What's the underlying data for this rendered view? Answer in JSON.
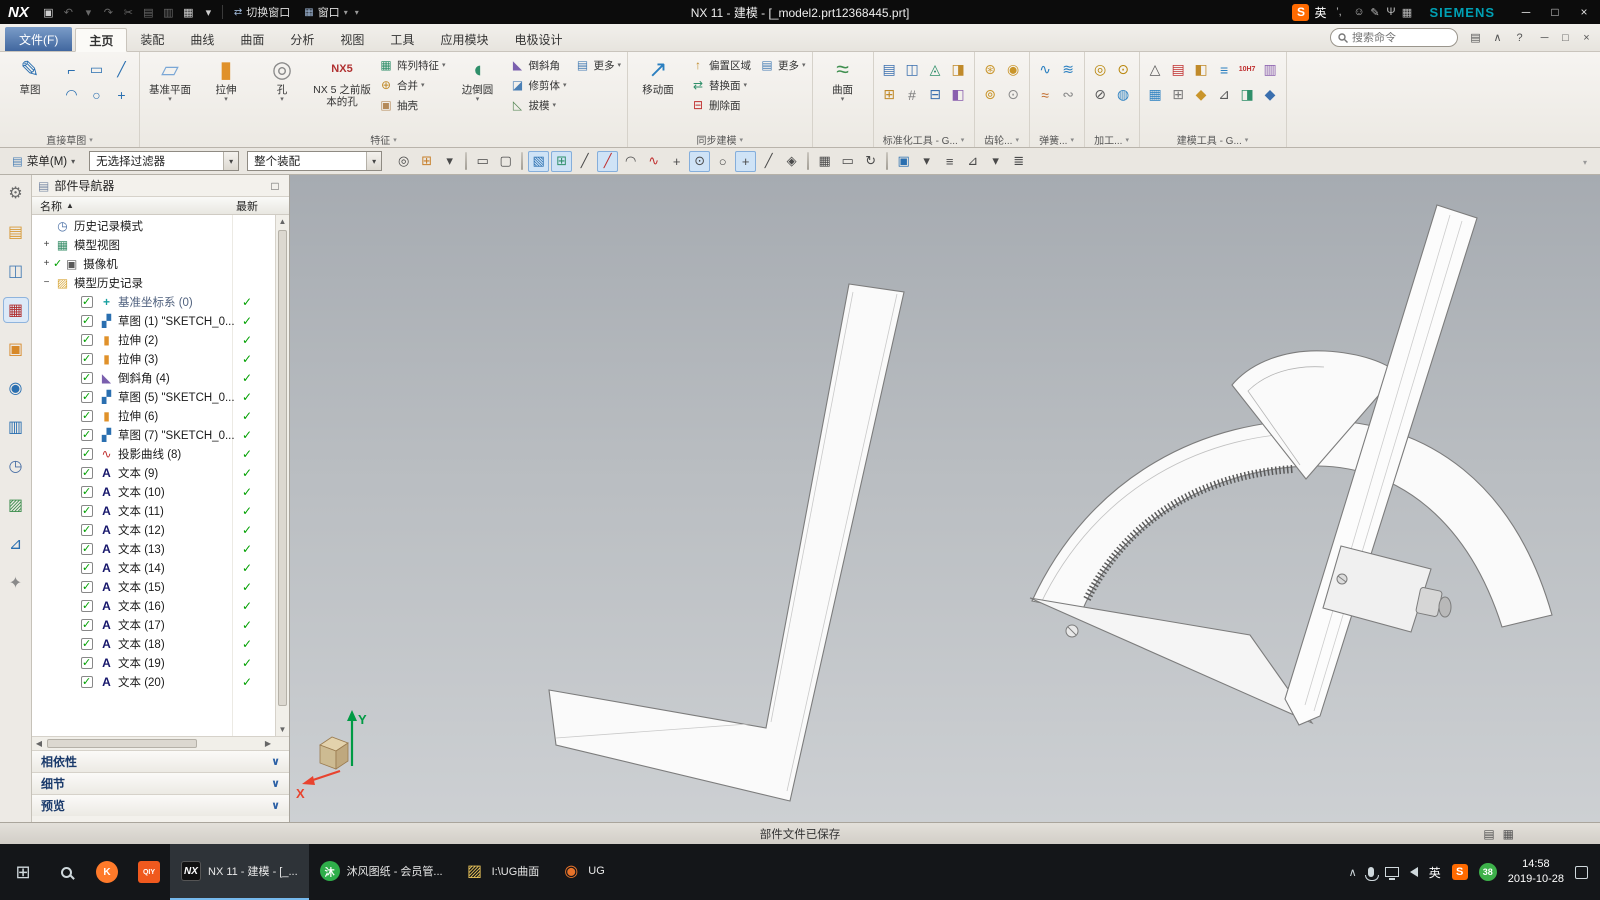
{
  "title_bar": {
    "logo": "NX",
    "title": "NX 11 - 建模 - [_model2.prt12368445.prt]",
    "qa_icons": [
      {
        "g": "▣",
        "n": "save-button"
      },
      {
        "g": "↶",
        "n": "undo-button",
        "dim": true
      },
      {
        "g": "▾",
        "n": "undo-caret",
        "dim": true
      },
      {
        "g": "↷",
        "n": "redo-button",
        "dim": true
      },
      {
        "g": "✂",
        "n": "cut-button",
        "dim": true
      },
      {
        "g": "▤",
        "n": "copy-button",
        "dim": true
      },
      {
        "g": "▥",
        "n": "paste-button",
        "dim": true
      },
      {
        "g": "▦",
        "n": "capture-button"
      },
      {
        "g": "▾",
        "n": "capture-caret"
      }
    ],
    "switch_window_icon": "⇄",
    "switch_window": "切换窗口",
    "window_icon": "▦",
    "window_menu": "窗口",
    "ime": {
      "sogou": "S",
      "lang": "英",
      "punct": "’,",
      "icons": [
        {
          "g": "☺",
          "n": "ime-emoji-icon"
        },
        {
          "g": "✎",
          "n": "ime-pen-icon"
        },
        {
          "g": "Ψ",
          "n": "ime-mic-icon"
        },
        {
          "g": "▦",
          "n": "ime-keyboard-icon"
        }
      ]
    },
    "brand": "SIEMENS",
    "window_controls": [
      {
        "g": "─",
        "n": "minimize-button"
      },
      {
        "g": "□",
        "n": "restore-button"
      },
      {
        "g": "×",
        "n": "close-button"
      }
    ]
  },
  "tabs": {
    "file": "文件(F)",
    "items": [
      {
        "label": "主页",
        "active": true
      },
      {
        "label": "装配"
      },
      {
        "label": "曲线"
      },
      {
        "label": "曲面"
      },
      {
        "label": "分析"
      },
      {
        "label": "视图"
      },
      {
        "label": "工具"
      },
      {
        "label": "应用模块"
      },
      {
        "label": "电极设计"
      }
    ],
    "search_placeholder": "搜索命令",
    "right_icons": [
      {
        "g": "▤",
        "n": "ribbon-options-icon"
      },
      {
        "g": "∧",
        "n": "minimize-ribbon-icon"
      },
      {
        "g": "?",
        "n": "help-icon"
      }
    ],
    "doc_controls": [
      {
        "g": "─",
        "n": "doc-minimize-button"
      },
      {
        "g": "□",
        "n": "doc-restore-button"
      },
      {
        "g": "×",
        "n": "doc-close-button"
      }
    ]
  },
  "ribbon": {
    "sketch": {
      "big": "草图",
      "icon": "✎",
      "label": "直接草图",
      "curves": [
        {
          "g": "⌐",
          "n": "profile-icon",
          "s": "color:#2a6fb0"
        },
        {
          "g": "▭",
          "n": "rectangle-icon",
          "s": "color:#2a6fb0"
        },
        {
          "g": "╱",
          "n": "line-icon",
          "s": "color:#2a6fb0"
        },
        {
          "g": "◠",
          "n": "arc-icon",
          "s": "color:#2a6fb0"
        },
        {
          "g": "○",
          "n": "circle-icon",
          "s": "color:#2a6fb0"
        },
        {
          "g": "+",
          "n": "point-icon",
          "s": "color:#2a6fb0"
        }
      ]
    },
    "feature": {
      "label": "特征",
      "datum": "基准平面",
      "extrude": "拉伸",
      "hole": "孔",
      "nx5hole": "NX 5 之前版本的孔",
      "pattern": "阵列特征",
      "unite": "合并",
      "shell": "抽壳",
      "blend": "边倒圆",
      "chamfer": "倒斜角",
      "trim": "修剪体",
      "draft": "拔模",
      "more": "更多",
      "icons": {
        "datum": "▱",
        "extrude": "▮",
        "hole": "◎",
        "nx5": "NX5",
        "pattern": "▦",
        "unite": "⊕",
        "shell": "▣",
        "blend": "◖",
        "chamfer": "◣",
        "trim": "◪",
        "draft": "◺",
        "more": "▤"
      }
    },
    "sync": {
      "label": "同步建模",
      "move": "移动面",
      "offset": "偏置区域",
      "replace": "替换面",
      "del": "删除面",
      "more": "更多",
      "icons": {
        "move": "↗",
        "offset": "↑",
        "replace": "⇄",
        "del": "⊟",
        "more": "▤"
      }
    },
    "surface": {
      "big": "曲面",
      "icon": "≈"
    },
    "std": {
      "label": "标准化工具 - G...",
      "icons": [
        {
          "g": "▤",
          "n": "std-tool-icon-1",
          "s": "color:#3a6fae"
        },
        {
          "g": "⊞",
          "n": "std-tool-icon-2",
          "s": "color:#c08a2a"
        },
        {
          "g": "◫",
          "n": "std-tool-icon-3",
          "s": "color:#3a6fae"
        },
        {
          "g": "#",
          "n": "std-tool-icon-4",
          "s": "color:#7a7a7a"
        },
        {
          "g": "◬",
          "n": "std-tool-icon-5",
          "s": "color:#2f8f6a"
        },
        {
          "g": "⊟",
          "n": "std-tool-icon-6",
          "s": "color:#3a6fae"
        },
        {
          "g": "◨",
          "n": "std-tool-icon-7",
          "s": "color:#c08a2a"
        },
        {
          "g": "◧",
          "n": "std-tool-icon-8",
          "s": "color:#8a5fae"
        }
      ]
    },
    "gear": {
      "label": "齿轮...",
      "icons": [
        {
          "g": "⊛",
          "n": "gear-tool-icon-1",
          "s": "color:#c9952a"
        },
        {
          "g": "⊚",
          "n": "gear-tool-icon-2",
          "s": "color:#c9952a"
        },
        {
          "g": "◉",
          "n": "gear-tool-icon-3",
          "s": "color:#c9952a"
        },
        {
          "g": "⊙",
          "n": "gear-tool-icon-4",
          "s": "color:#8a8a8a"
        }
      ]
    },
    "spring": {
      "label": "弹簧...",
      "icons": [
        {
          "g": "∿",
          "n": "spring-tool-icon-1",
          "s": "color:#2a7fc0"
        },
        {
          "g": "≈",
          "n": "spring-tool-icon-2",
          "s": "color:#c06a2a"
        },
        {
          "g": "≋",
          "n": "spring-tool-icon-3",
          "s": "color:#2a7fc0"
        },
        {
          "g": "∾",
          "n": "spring-tool-icon-4",
          "s": "color:#8a8a8a"
        }
      ]
    },
    "mach": {
      "label": "加工...",
      "icons": [
        {
          "g": "◎",
          "n": "machining-tool-icon-1",
          "s": "color:#b8860b"
        },
        {
          "g": "⊘",
          "n": "machining-tool-icon-2",
          "s": "color:#5a5a5a"
        },
        {
          "g": "⊙",
          "n": "machining-tool-icon-3",
          "s": "color:#b8860b"
        },
        {
          "g": "◍",
          "n": "machining-tool-icon-4",
          "s": "color:#2a7fc0"
        }
      ]
    },
    "mod": {
      "label": "建模工具 - G...",
      "icons": [
        {
          "g": "△",
          "n": "modeling-tool-icon-1",
          "s": "color:#5a5a5a"
        },
        {
          "g": "▦",
          "n": "modeling-tool-icon-2",
          "s": "color:#2a7fc0"
        },
        {
          "g": "▤",
          "n": "modeling-tool-icon-3",
          "s": "color:#c03030"
        },
        {
          "g": "⊞",
          "n": "modeling-tool-icon-4",
          "s": "color:#7a7a7a"
        },
        {
          "g": "◧",
          "n": "modeling-tool-icon-5",
          "s": "color:#c08a2a"
        },
        {
          "g": "◆",
          "n": "modeling-tool-icon-6",
          "s": "color:#c9952a"
        },
        {
          "g": "≡",
          "n": "modeling-tool-icon-7",
          "s": "color:#2a7fc0"
        },
        {
          "g": "⊿",
          "n": "modeling-tool-icon-8",
          "s": "color:#5a5a5a"
        },
        {
          "g": "10H7",
          "n": "modeling-tool-icon-9",
          "s": "color:#c03030;font-size:7px;font-weight:bold"
        },
        {
          "g": "◨",
          "n": "modeling-tool-icon-10",
          "s": "color:#2f8f6a"
        },
        {
          "g": "▥",
          "n": "modeling-tool-icon-11",
          "s": "color:#8a5fae"
        },
        {
          "g": "◆",
          "n": "modeling-tool-icon-12",
          "s": "color:#3a6fae"
        }
      ]
    }
  },
  "toolbar2": {
    "menu_icon": "▤",
    "menu": "菜单(M)",
    "filter_value": "无选择过滤器",
    "scope_value": "整个装配",
    "icons": [
      {
        "g": "◎",
        "n": "magnify-cursor-icon"
      },
      {
        "g": "⊞",
        "n": "quick-pick-icon",
        "s": "color:#c77f2a"
      },
      {
        "g": "▾",
        "n": "selection-options-caret"
      },
      {
        "sep": true,
        "n": "separator"
      },
      {
        "g": "▭",
        "n": "rect-select-icon"
      },
      {
        "g": "▢",
        "n": "lasso-select-icon"
      },
      {
        "sep": true,
        "n": "separator"
      },
      {
        "g": "▧",
        "n": "shaded-view-icon",
        "active": true,
        "s": "color:#2a6fb0"
      },
      {
        "g": "⊞",
        "n": "color-grid-icon",
        "active": true,
        "s": "color:#2f8f6a"
      },
      {
        "g": "╱",
        "n": "snap-endpoint-icon"
      },
      {
        "g": "╱",
        "n": "snap-midpoint-icon",
        "active": true,
        "s": "color:#c03030"
      },
      {
        "g": "◠",
        "n": "snap-arc-icon"
      },
      {
        "g": "∿",
        "n": "snap-spline-icon",
        "s": "color:#c03030"
      },
      {
        "g": "+",
        "n": "snap-point-icon"
      },
      {
        "g": "⊙",
        "n": "snap-center-icon",
        "active": true
      },
      {
        "g": "○",
        "n": "snap-circle-icon"
      },
      {
        "g": "+",
        "n": "snap-intersection-icon",
        "active": true
      },
      {
        "g": "╱",
        "n": "snap-tangent-icon"
      },
      {
        "g": "◈",
        "n": "snap-quadrant-icon"
      },
      {
        "sep": true,
        "n": "separator"
      },
      {
        "g": "▦",
        "n": "wcs-dynamics-icon"
      },
      {
        "g": "▭",
        "n": "fit-window-icon"
      },
      {
        "g": "↻",
        "n": "rotate-view-icon"
      },
      {
        "sep": true,
        "n": "separator"
      },
      {
        "g": "▣",
        "n": "render-style-icon",
        "s": "color:#2a6fb0"
      },
      {
        "g": "▾",
        "n": "render-style-caret"
      },
      {
        "g": "≡",
        "n": "part-list-icon"
      },
      {
        "g": "⊿",
        "n": "datum-triangle-icon"
      },
      {
        "g": "▾",
        "n": "more-tools-caret"
      },
      {
        "g": "≣",
        "n": "layer-list-icon"
      }
    ]
  },
  "resource_bar": {
    "icons": [
      {
        "g": "⚙",
        "n": "resource-options-icon",
        "s": "color:#6a6a6a"
      },
      {
        "g": "▤",
        "n": "assembly-navigator-icon",
        "s": "color:#d79b3a"
      },
      {
        "g": "◫",
        "n": "constraint-navigator-icon",
        "s": "color:#4a7fb5"
      },
      {
        "g": "▦",
        "n": "part-navigator-icon",
        "s": "color:#b03030",
        "active": true
      },
      {
        "g": "▣",
        "n": "reuse-library-icon",
        "s": "color:#d7892a"
      },
      {
        "g": "◉",
        "n": "web-browser-icon",
        "s": "color:#2a6fb0"
      },
      {
        "g": "▥",
        "n": "hd3d-tool-icon",
        "s": "color:#2a6fb0"
      },
      {
        "g": "◷",
        "n": "history-icon",
        "s": "color:#4a6fa5"
      },
      {
        "g": "▨",
        "n": "materials-icon",
        "s": "color:#3f8f4f"
      },
      {
        "g": "⊿",
        "n": "process-studio-icon",
        "s": "color:#2a6fb0"
      },
      {
        "g": "✦",
        "n": "roles-icon",
        "s": "color:#8a8a8a"
      }
    ]
  },
  "navigator": {
    "title": "部件导航器",
    "header_icon": "▤",
    "pin": "□",
    "col_name": "名称",
    "sort_glyph": "▲",
    "col_latest": "最新",
    "items": [
      {
        "exp": "",
        "ig": "◷",
        "is": "color:#4a6fa5",
        "label": "历史记录模式",
        "st": ""
      },
      {
        "exp": "+",
        "ig": "▦",
        "is": "color:#3a8f6a",
        "label": "模型视图",
        "st": ""
      },
      {
        "exp": "+",
        "pre": "✓",
        "ig": "▣",
        "is": "color:#5a5a5a",
        "label": "摄像机",
        "st": ""
      },
      {
        "exp": "−",
        "ig": "▨",
        "is": "color:#d7a73a",
        "label": "模型历史记录",
        "st": ""
      },
      {
        "child": true,
        "cb": true,
        "ig": "+",
        "is": "color:#18a0a0;font-weight:bold",
        "label": "基准坐标系 (0)",
        "st": "✓",
        "dim": true
      },
      {
        "child": true,
        "cb": true,
        "ig": "▞",
        "is": "color:#2a6fb0",
        "label": "草图 (1) \"SKETCH_0...",
        "st": "✓"
      },
      {
        "child": true,
        "cb": true,
        "ig": "▮",
        "is": "color:#e0912a",
        "label": "拉伸 (2)",
        "st": "✓"
      },
      {
        "child": true,
        "cb": true,
        "ig": "▮",
        "is": "color:#e0912a",
        "label": "拉伸 (3)",
        "st": "✓"
      },
      {
        "child": true,
        "cb": true,
        "ig": "◣",
        "is": "color:#7a5fae",
        "label": "倒斜角 (4)",
        "st": "✓"
      },
      {
        "child": true,
        "cb": true,
        "ig": "▞",
        "is": "color:#2a6fb0",
        "label": "草图 (5) \"SKETCH_0...",
        "st": "✓"
      },
      {
        "child": true,
        "cb": true,
        "ig": "▮",
        "is": "color:#e0912a",
        "label": "拉伸 (6)",
        "st": "✓"
      },
      {
        "child": true,
        "cb": true,
        "ig": "▞",
        "is": "color:#2a6fb0",
        "label": "草图 (7) \"SKETCH_0...",
        "st": "✓"
      },
      {
        "child": true,
        "cb": true,
        "ig": "∿",
        "is": "color:#c03030",
        "label": "投影曲线 (8)",
        "st": "✓"
      },
      {
        "child": true,
        "cb": true,
        "ig": "A",
        "is": "color:#16166b;font-weight:bold",
        "label": "文本 (9)",
        "st": "✓"
      },
      {
        "child": true,
        "cb": true,
        "ig": "A",
        "is": "color:#16166b;font-weight:bold",
        "label": "文本 (10)",
        "st": "✓"
      },
      {
        "child": true,
        "cb": true,
        "ig": "A",
        "is": "color:#16166b;font-weight:bold",
        "label": "文本 (11)",
        "st": "✓"
      },
      {
        "child": true,
        "cb": true,
        "ig": "A",
        "is": "color:#16166b;font-weight:bold",
        "label": "文本 (12)",
        "st": "✓"
      },
      {
        "child": true,
        "cb": true,
        "ig": "A",
        "is": "color:#16166b;font-weight:bold",
        "label": "文本 (13)",
        "st": "✓"
      },
      {
        "child": true,
        "cb": true,
        "ig": "A",
        "is": "color:#16166b;font-weight:bold",
        "label": "文本 (14)",
        "st": "✓"
      },
      {
        "child": true,
        "cb": true,
        "ig": "A",
        "is": "color:#16166b;font-weight:bold",
        "label": "文本 (15)",
        "st": "✓"
      },
      {
        "child": true,
        "cb": true,
        "ig": "A",
        "is": "color:#16166b;font-weight:bold",
        "label": "文本 (16)",
        "st": "✓"
      },
      {
        "child": true,
        "cb": true,
        "ig": "A",
        "is": "color:#16166b;font-weight:bold",
        "label": "文本 (17)",
        "st": "✓"
      },
      {
        "child": true,
        "cb": true,
        "ig": "A",
        "is": "color:#16166b;font-weight:bold",
        "label": "文本 (18)",
        "st": "✓"
      },
      {
        "child": true,
        "cb": true,
        "ig": "A",
        "is": "color:#16166b;font-weight:bold",
        "label": "文本 (19)",
        "st": "✓"
      },
      {
        "child": true,
        "cb": true,
        "ig": "A",
        "is": "color:#16166b;font-weight:bold",
        "label": "文本 (20)",
        "st": "✓"
      }
    ],
    "sections": [
      {
        "label": "相依性",
        "n": "dependencies-section"
      },
      {
        "label": "细节",
        "n": "details-section"
      },
      {
        "label": "预览",
        "n": "preview-section"
      }
    ]
  },
  "viewport": {
    "triad_x": "X",
    "triad_y": "Y"
  },
  "status_bar": {
    "message": "部件文件已保存",
    "icons": [
      {
        "g": "▤",
        "n": "status-grid-icon"
      },
      {
        "g": "▦",
        "n": "status-panel-icon"
      }
    ]
  },
  "taskbar": {
    "start": "⊞",
    "pinned": [
      {
        "t": "K",
        "n": "pinned-app-k",
        "s": "background:#ff7a2a;border-radius:50%"
      },
      {
        "t": "QIY",
        "n": "pinned-app-iqiyi",
        "s": "background:#f0591e;font-size:7px"
      }
    ],
    "tasks": [
      {
        "t": "NX",
        "label": "NX 11 - 建模 - [_...",
        "n": "task-nx",
        "active": true,
        "s": "background:#111;border:1px solid #555;font-style:italic"
      },
      {
        "t": "沐",
        "label": "沐风图纸 - 会员管...",
        "n": "task-mufeng",
        "s": "background:#2fae4a;border-radius:50%"
      },
      {
        "t": "▨",
        "label": "I:\\UG曲面",
        "n": "task-ug-folder",
        "s": "background:transparent;color:#e8c35a;font-size:16px"
      },
      {
        "t": "◉",
        "label": "UG",
        "n": "task-ug-browser",
        "s": "background:transparent;color:#e8732a;font-size:16px"
      }
    ],
    "tray_lang": "英",
    "tray_sogou": "S",
    "tray_badge": "38",
    "time": "14:58",
    "date": "2019-10-28"
  }
}
